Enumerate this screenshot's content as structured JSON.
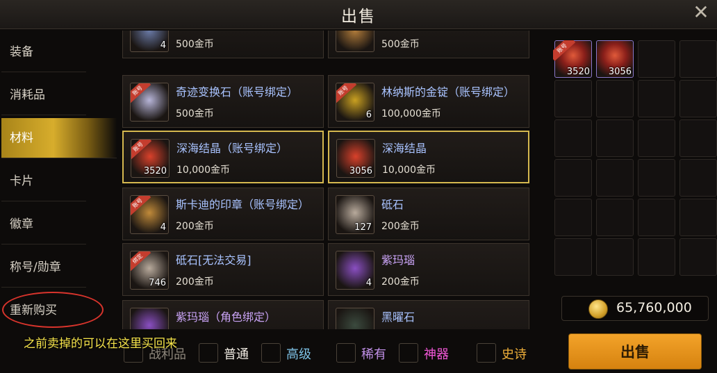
{
  "title": "出售",
  "sidebar": {
    "items": [
      {
        "label": "装备"
      },
      {
        "label": "消耗品"
      },
      {
        "label": "材料",
        "active": true
      },
      {
        "label": "卡片"
      },
      {
        "label": "徽章"
      },
      {
        "label": "称号/勋章"
      },
      {
        "label": "重新购买"
      }
    ]
  },
  "items": [
    {
      "name": "",
      "price": "500金币",
      "qty": "4",
      "icon": "device-icon",
      "color": "#6a7aa6"
    },
    {
      "name": "",
      "price": "500金币",
      "qty": "",
      "icon": "cookie-icon",
      "color": "#b07b3a"
    },
    {
      "name": "奇迹变换石（账号绑定）",
      "price": "500金币",
      "qty": "",
      "tag": "账号",
      "icon": "crystal-icon",
      "color": "#b7b5d8"
    },
    {
      "name": "林纳斯的金锭（账号绑定）",
      "price": "100,000金币",
      "qty": "6",
      "tag": "账号",
      "icon": "gold-ingot-icon",
      "color": "#c9a021"
    },
    {
      "name": "深海结晶（账号绑定）",
      "price": "10,000金币",
      "qty": "3520",
      "tag": "账号",
      "icon": "deep-sea-crystal-icon",
      "color": "#d9412b",
      "selected": true
    },
    {
      "name": "深海结晶",
      "price": "10,000金币",
      "qty": "3056",
      "icon": "deep-sea-crystal-icon",
      "color": "#d9412b",
      "selected": true
    },
    {
      "name": "斯卡迪的印章（账号绑定）",
      "price": "200金币",
      "qty": "4",
      "tag": "账号",
      "icon": "seal-icon",
      "color": "#c08a3a"
    },
    {
      "name": "砥石",
      "price": "200金币",
      "qty": "127",
      "icon": "whetstone-icon",
      "color": "#b8aa9c"
    },
    {
      "name": "砥石[无法交易]",
      "price": "200金币",
      "qty": "746",
      "tag": "绑定",
      "icon": "whetstone-icon",
      "color": "#b8aa9c"
    },
    {
      "name": "紫玛瑙",
      "price": "200金币",
      "qty": "4",
      "icon": "purple-agate-icon",
      "color": "#8a4fc2"
    },
    {
      "name": "紫玛瑙（角色绑定）",
      "price": "",
      "qty": "",
      "icon": "purple-agate-icon",
      "color": "#8a4fc2"
    },
    {
      "name": "黑曜石",
      "price": "",
      "qty": "",
      "icon": "obsidian-icon",
      "color": "#3b4a3e"
    }
  ],
  "inventory": [
    {
      "qty": "3520",
      "tag": "账号",
      "icon": "deep-sea-crystal-icon"
    },
    {
      "qty": "3056",
      "icon": "deep-sea-crystal-icon"
    }
  ],
  "gold": "65,760,000",
  "sell_button": "出售",
  "filters": [
    {
      "label": "战利品",
      "color": "#8c857a"
    },
    {
      "label": "普通",
      "color": "#f2ede4"
    },
    {
      "label": "高级",
      "color": "#7ec2e6"
    },
    {
      "label": "稀有",
      "color": "#c190e8"
    },
    {
      "label": "神器",
      "color": "#f257d8"
    },
    {
      "label": "史诗",
      "color": "#f0b03a"
    }
  ],
  "annotation": "之前卖掉的可以在这里买回来"
}
